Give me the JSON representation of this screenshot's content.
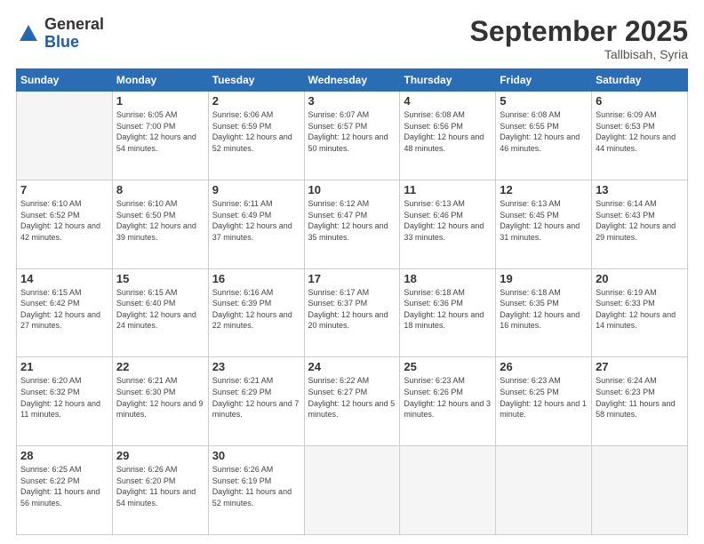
{
  "logo": {
    "general": "General",
    "blue": "Blue"
  },
  "header": {
    "month": "September 2025",
    "location": "Tallbisah, Syria"
  },
  "days_of_week": [
    "Sunday",
    "Monday",
    "Tuesday",
    "Wednesday",
    "Thursday",
    "Friday",
    "Saturday"
  ],
  "weeks": [
    [
      {
        "day": "",
        "sunrise": "",
        "sunset": "",
        "daylight": ""
      },
      {
        "day": "1",
        "sunrise": "6:05 AM",
        "sunset": "7:00 PM",
        "daylight": "12 hours and 54 minutes."
      },
      {
        "day": "2",
        "sunrise": "6:06 AM",
        "sunset": "6:59 PM",
        "daylight": "12 hours and 52 minutes."
      },
      {
        "day": "3",
        "sunrise": "6:07 AM",
        "sunset": "6:57 PM",
        "daylight": "12 hours and 50 minutes."
      },
      {
        "day": "4",
        "sunrise": "6:08 AM",
        "sunset": "6:56 PM",
        "daylight": "12 hours and 48 minutes."
      },
      {
        "day": "5",
        "sunrise": "6:08 AM",
        "sunset": "6:55 PM",
        "daylight": "12 hours and 46 minutes."
      },
      {
        "day": "6",
        "sunrise": "6:09 AM",
        "sunset": "6:53 PM",
        "daylight": "12 hours and 44 minutes."
      }
    ],
    [
      {
        "day": "7",
        "sunrise": "6:10 AM",
        "sunset": "6:52 PM",
        "daylight": "12 hours and 42 minutes."
      },
      {
        "day": "8",
        "sunrise": "6:10 AM",
        "sunset": "6:50 PM",
        "daylight": "12 hours and 39 minutes."
      },
      {
        "day": "9",
        "sunrise": "6:11 AM",
        "sunset": "6:49 PM",
        "daylight": "12 hours and 37 minutes."
      },
      {
        "day": "10",
        "sunrise": "6:12 AM",
        "sunset": "6:47 PM",
        "daylight": "12 hours and 35 minutes."
      },
      {
        "day": "11",
        "sunrise": "6:13 AM",
        "sunset": "6:46 PM",
        "daylight": "12 hours and 33 minutes."
      },
      {
        "day": "12",
        "sunrise": "6:13 AM",
        "sunset": "6:45 PM",
        "daylight": "12 hours and 31 minutes."
      },
      {
        "day": "13",
        "sunrise": "6:14 AM",
        "sunset": "6:43 PM",
        "daylight": "12 hours and 29 minutes."
      }
    ],
    [
      {
        "day": "14",
        "sunrise": "6:15 AM",
        "sunset": "6:42 PM",
        "daylight": "12 hours and 27 minutes."
      },
      {
        "day": "15",
        "sunrise": "6:15 AM",
        "sunset": "6:40 PM",
        "daylight": "12 hours and 24 minutes."
      },
      {
        "day": "16",
        "sunrise": "6:16 AM",
        "sunset": "6:39 PM",
        "daylight": "12 hours and 22 minutes."
      },
      {
        "day": "17",
        "sunrise": "6:17 AM",
        "sunset": "6:37 PM",
        "daylight": "12 hours and 20 minutes."
      },
      {
        "day": "18",
        "sunrise": "6:18 AM",
        "sunset": "6:36 PM",
        "daylight": "12 hours and 18 minutes."
      },
      {
        "day": "19",
        "sunrise": "6:18 AM",
        "sunset": "6:35 PM",
        "daylight": "12 hours and 16 minutes."
      },
      {
        "day": "20",
        "sunrise": "6:19 AM",
        "sunset": "6:33 PM",
        "daylight": "12 hours and 14 minutes."
      }
    ],
    [
      {
        "day": "21",
        "sunrise": "6:20 AM",
        "sunset": "6:32 PM",
        "daylight": "12 hours and 11 minutes."
      },
      {
        "day": "22",
        "sunrise": "6:21 AM",
        "sunset": "6:30 PM",
        "daylight": "12 hours and 9 minutes."
      },
      {
        "day": "23",
        "sunrise": "6:21 AM",
        "sunset": "6:29 PM",
        "daylight": "12 hours and 7 minutes."
      },
      {
        "day": "24",
        "sunrise": "6:22 AM",
        "sunset": "6:27 PM",
        "daylight": "12 hours and 5 minutes."
      },
      {
        "day": "25",
        "sunrise": "6:23 AM",
        "sunset": "6:26 PM",
        "daylight": "12 hours and 3 minutes."
      },
      {
        "day": "26",
        "sunrise": "6:23 AM",
        "sunset": "6:25 PM",
        "daylight": "12 hours and 1 minute."
      },
      {
        "day": "27",
        "sunrise": "6:24 AM",
        "sunset": "6:23 PM",
        "daylight": "11 hours and 58 minutes."
      }
    ],
    [
      {
        "day": "28",
        "sunrise": "6:25 AM",
        "sunset": "6:22 PM",
        "daylight": "11 hours and 56 minutes."
      },
      {
        "day": "29",
        "sunrise": "6:26 AM",
        "sunset": "6:20 PM",
        "daylight": "11 hours and 54 minutes."
      },
      {
        "day": "30",
        "sunrise": "6:26 AM",
        "sunset": "6:19 PM",
        "daylight": "11 hours and 52 minutes."
      },
      {
        "day": "",
        "sunrise": "",
        "sunset": "",
        "daylight": ""
      },
      {
        "day": "",
        "sunrise": "",
        "sunset": "",
        "daylight": ""
      },
      {
        "day": "",
        "sunrise": "",
        "sunset": "",
        "daylight": ""
      },
      {
        "day": "",
        "sunrise": "",
        "sunset": "",
        "daylight": ""
      }
    ]
  ]
}
